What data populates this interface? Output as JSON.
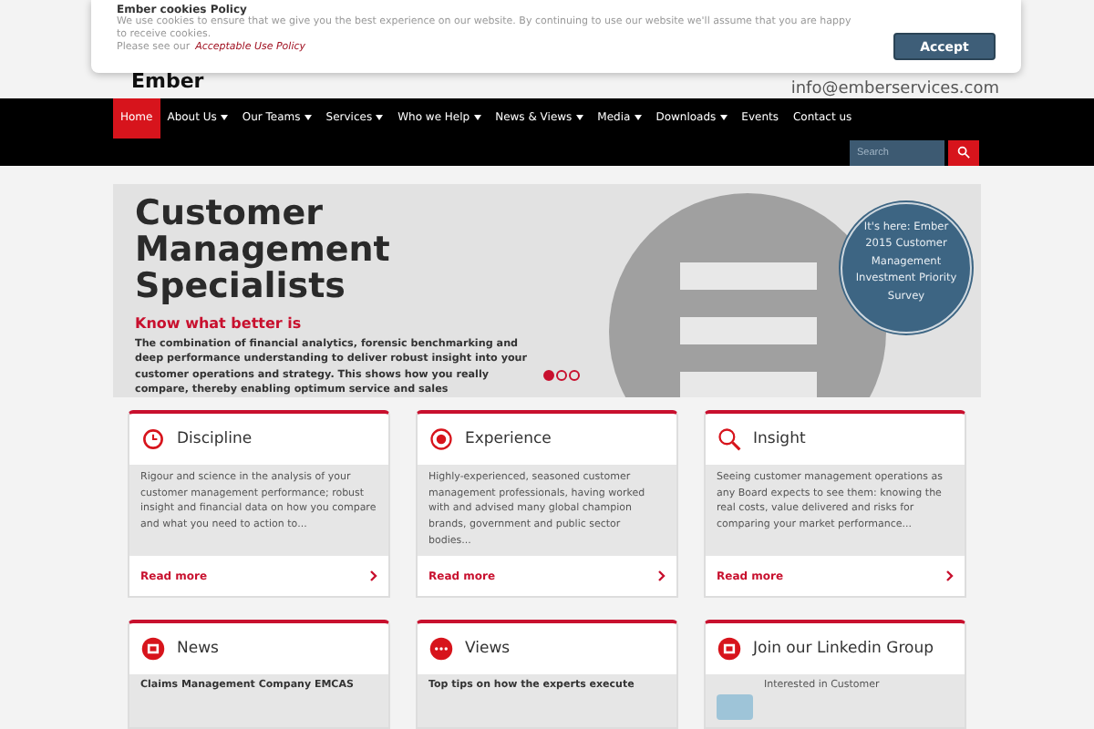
{
  "cookie_banner": {
    "title": "Ember cookies Policy",
    "text": "We use cookies to ensure that we give you the best experience on our website. By continuing to use our website we'll assume that you are happy to receive cookies.",
    "policy_prefix": "Please see our",
    "policy_link": "Acceptable Use Policy",
    "button": "Accept"
  },
  "header": {
    "logo": "Ember",
    "email": "info@emberservices.com"
  },
  "nav": {
    "items": [
      {
        "label": "Home",
        "selected": true,
        "dropdown": false
      },
      {
        "label": "About Us",
        "selected": false,
        "dropdown": true
      },
      {
        "label": "Our Teams",
        "selected": false,
        "dropdown": true
      },
      {
        "label": "Services",
        "selected": false,
        "dropdown": true
      },
      {
        "label": "Who we Help",
        "selected": false,
        "dropdown": true
      },
      {
        "label": "News & Views",
        "selected": false,
        "dropdown": true
      },
      {
        "label": "Media",
        "selected": false,
        "dropdown": true
      },
      {
        "label": "Downloads",
        "selected": false,
        "dropdown": true
      },
      {
        "label": "Events",
        "selected": false,
        "dropdown": false
      },
      {
        "label": "Contact us",
        "selected": false,
        "dropdown": false
      }
    ],
    "search": {
      "placeholder": "Search"
    }
  },
  "hero": {
    "title": "Customer Management Specialists",
    "subtitle": "Know what better is",
    "text": "The combination of financial analytics, forensic benchmarking and deep performance understanding to deliver robust insight into your customer operations and strategy. This shows how you really compare, thereby enabling optimum service and sales",
    "badge": "It's here: Ember 2015 Customer Management Investment Priority Survey",
    "dots": [
      {
        "selected": true
      },
      {
        "selected": false
      },
      {
        "selected": false
      }
    ]
  },
  "cards": [
    {
      "title": "Discipline",
      "kind": "clock",
      "text": "Rigour and science in the analysis of your customer management performance; robust insight and financial data on how you compare and what you need to action to...",
      "link": "Read more"
    },
    {
      "title": "Experience",
      "kind": "target",
      "text": "Highly-experienced, seasoned customer management professionals, having worked with and advised many global champion brands, government and public sector bodies...",
      "link": "Read more"
    },
    {
      "title": "Insight",
      "kind": "search",
      "text": "Seeing customer management operations as any Board expects to see them: knowing the real costs, value delivered and risks for comparing your market performance...",
      "link": "Read more"
    }
  ],
  "bottom_cards": [
    {
      "title": "News",
      "kind": "news",
      "text": "Claims Management Company EMCAS"
    },
    {
      "title": "Views",
      "kind": "chat",
      "text": "Top tips on how the experts execute"
    },
    {
      "title": "Join our Linkedin Group",
      "kind": "linkedin",
      "text": "Interested in Customer"
    }
  ]
}
